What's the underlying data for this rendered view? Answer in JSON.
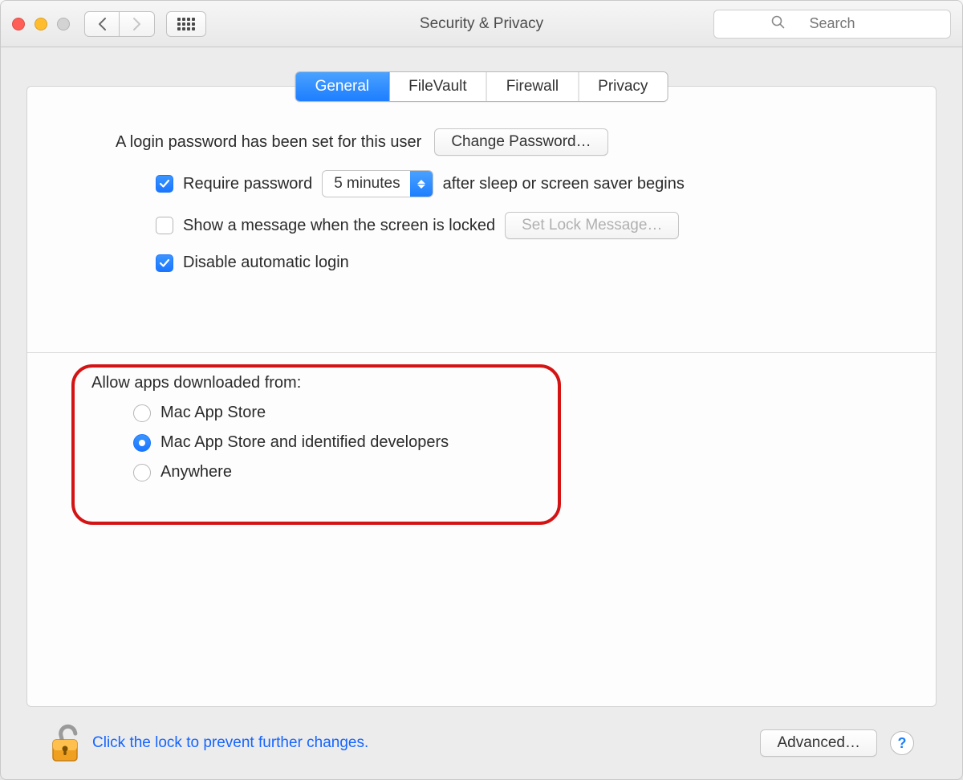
{
  "window": {
    "title": "Security & Privacy"
  },
  "toolbar": {
    "search_placeholder": "Search"
  },
  "tabs": {
    "items": [
      "General",
      "FileVault",
      "Firewall",
      "Privacy"
    ],
    "active": 0
  },
  "general": {
    "login_password_set": "A login password has been set for this user",
    "change_password_btn": "Change Password…",
    "require_password_label": "Require password",
    "require_password_checked": true,
    "delay_value": "5 minutes",
    "after_sleep_label": "after sleep or screen saver begins",
    "show_message_label": "Show a message when the screen is locked",
    "show_message_checked": false,
    "set_lock_message_btn": "Set Lock Message…",
    "disable_auto_login_label": "Disable automatic login",
    "disable_auto_login_checked": true
  },
  "gatekeeper": {
    "title": "Allow apps downloaded from:",
    "options": [
      "Mac App Store",
      "Mac App Store and identified developers",
      "Anywhere"
    ],
    "selected": 1
  },
  "footer": {
    "lock_text": "Click the lock to prevent further changes.",
    "advanced_btn": "Advanced…",
    "help_label": "?"
  }
}
